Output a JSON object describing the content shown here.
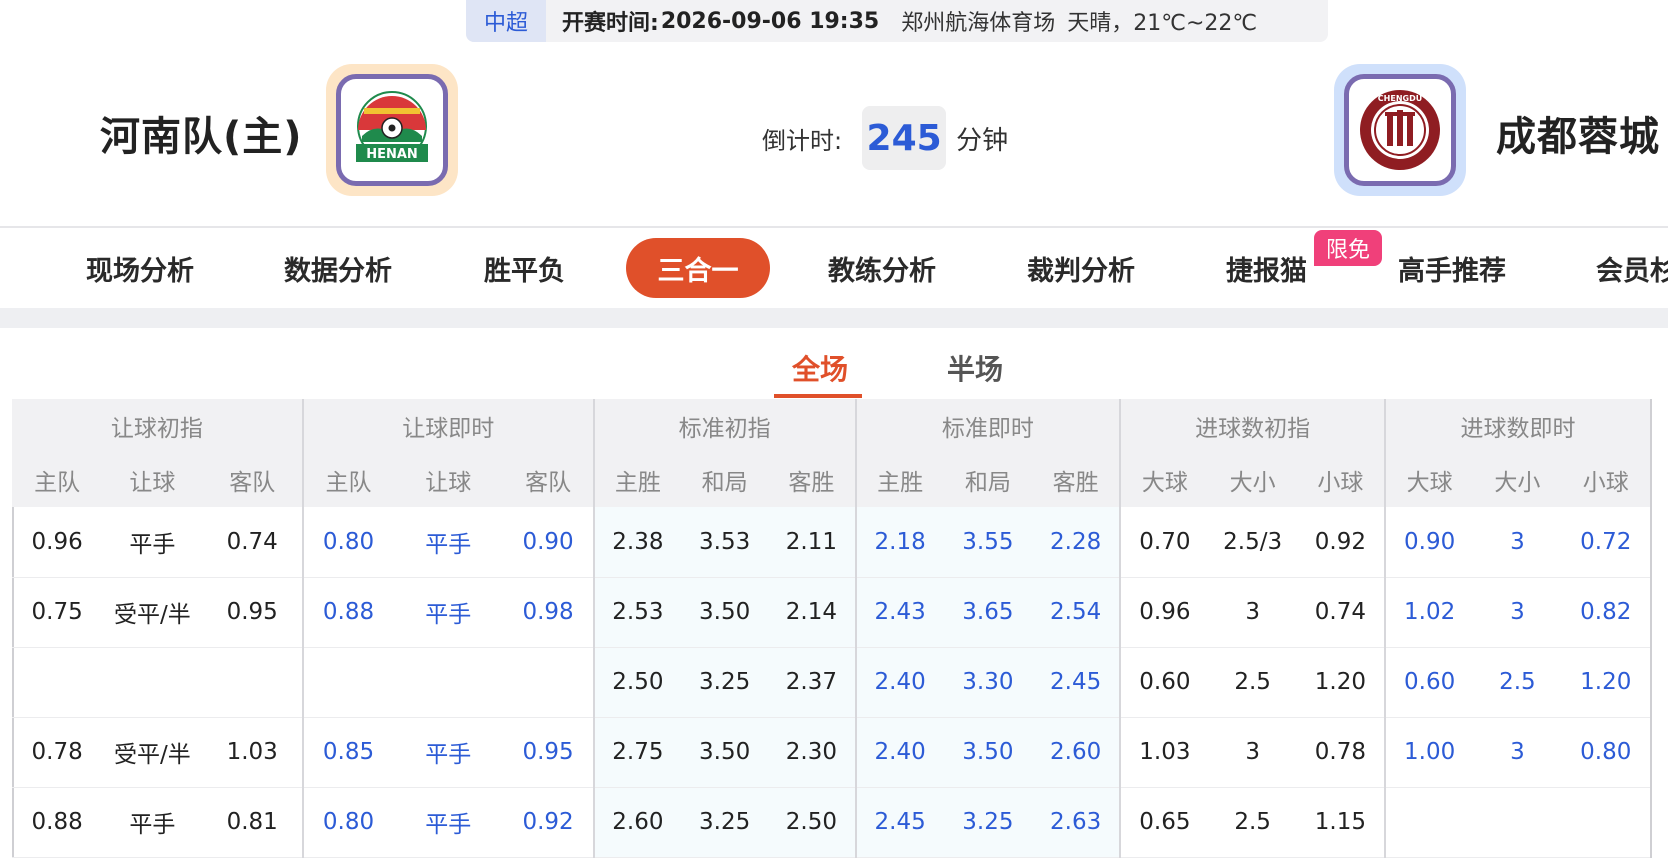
{
  "match": {
    "league": "中超",
    "kickoff_label": "开赛时间:",
    "kickoff_time": "2026-09-06 19:35",
    "venue": "郑州航海体育场",
    "weather": "天晴，21℃~22℃",
    "home_team": "河南队(主)",
    "away_team": "成都蓉城",
    "home_logo_text": "HENAN",
    "away_logo_text": "CHENGDU",
    "countdown_label": "倒计时:",
    "countdown_value": "245",
    "countdown_unit": "分钟"
  },
  "nav": {
    "items": [
      "现场分析",
      "数据分析",
      "胜平负",
      "三合一",
      "教练分析",
      "裁判分析",
      "捷报猫",
      "高手推荐",
      "会员杉"
    ],
    "active": "三合一",
    "badge": "限免"
  },
  "subtabs": [
    "全场",
    "半场"
  ],
  "table": {
    "groups": [
      "让球初指",
      "让球即时",
      "标准初指",
      "标准即时",
      "进球数初指",
      "进球数即时"
    ],
    "columns": [
      "主队",
      "让球",
      "客队",
      "主队",
      "让球",
      "客队",
      "主胜",
      "和局",
      "客胜",
      "主胜",
      "和局",
      "客胜",
      "大球",
      "大小",
      "小球",
      "大球",
      "大小",
      "小球"
    ],
    "rows": [
      [
        "0.96",
        "平手",
        "0.74",
        "0.80",
        "平手",
        "0.90",
        "2.38",
        "3.53",
        "2.11",
        "2.18",
        "3.55",
        "2.28",
        "0.70",
        "2.5/3",
        "0.92",
        "0.90",
        "3",
        "0.72"
      ],
      [
        "0.75",
        "受平/半",
        "0.95",
        "0.88",
        "平手",
        "0.98",
        "2.53",
        "3.50",
        "2.14",
        "2.43",
        "3.65",
        "2.54",
        "0.96",
        "3",
        "0.74",
        "1.02",
        "3",
        "0.82"
      ],
      [
        "",
        "",
        "",
        "",
        "",
        "",
        "2.50",
        "3.25",
        "2.37",
        "2.40",
        "3.30",
        "2.45",
        "0.60",
        "2.5",
        "1.20",
        "0.60",
        "2.5",
        "1.20"
      ],
      [
        "0.78",
        "受平/半",
        "1.03",
        "0.85",
        "平手",
        "0.95",
        "2.75",
        "3.50",
        "2.30",
        "2.40",
        "3.50",
        "2.60",
        "1.03",
        "3",
        "0.78",
        "1.00",
        "3",
        "0.80"
      ],
      [
        "0.88",
        "平手",
        "0.81",
        "0.80",
        "平手",
        "0.92",
        "2.60",
        "3.25",
        "2.50",
        "2.45",
        "3.25",
        "2.63",
        "0.65",
        "2.5",
        "1.15",
        "",
        "",
        ""
      ]
    ]
  },
  "colors": {
    "accent": "#e0502a",
    "blue": "#2c5bd6",
    "badge": "#f0407a"
  }
}
